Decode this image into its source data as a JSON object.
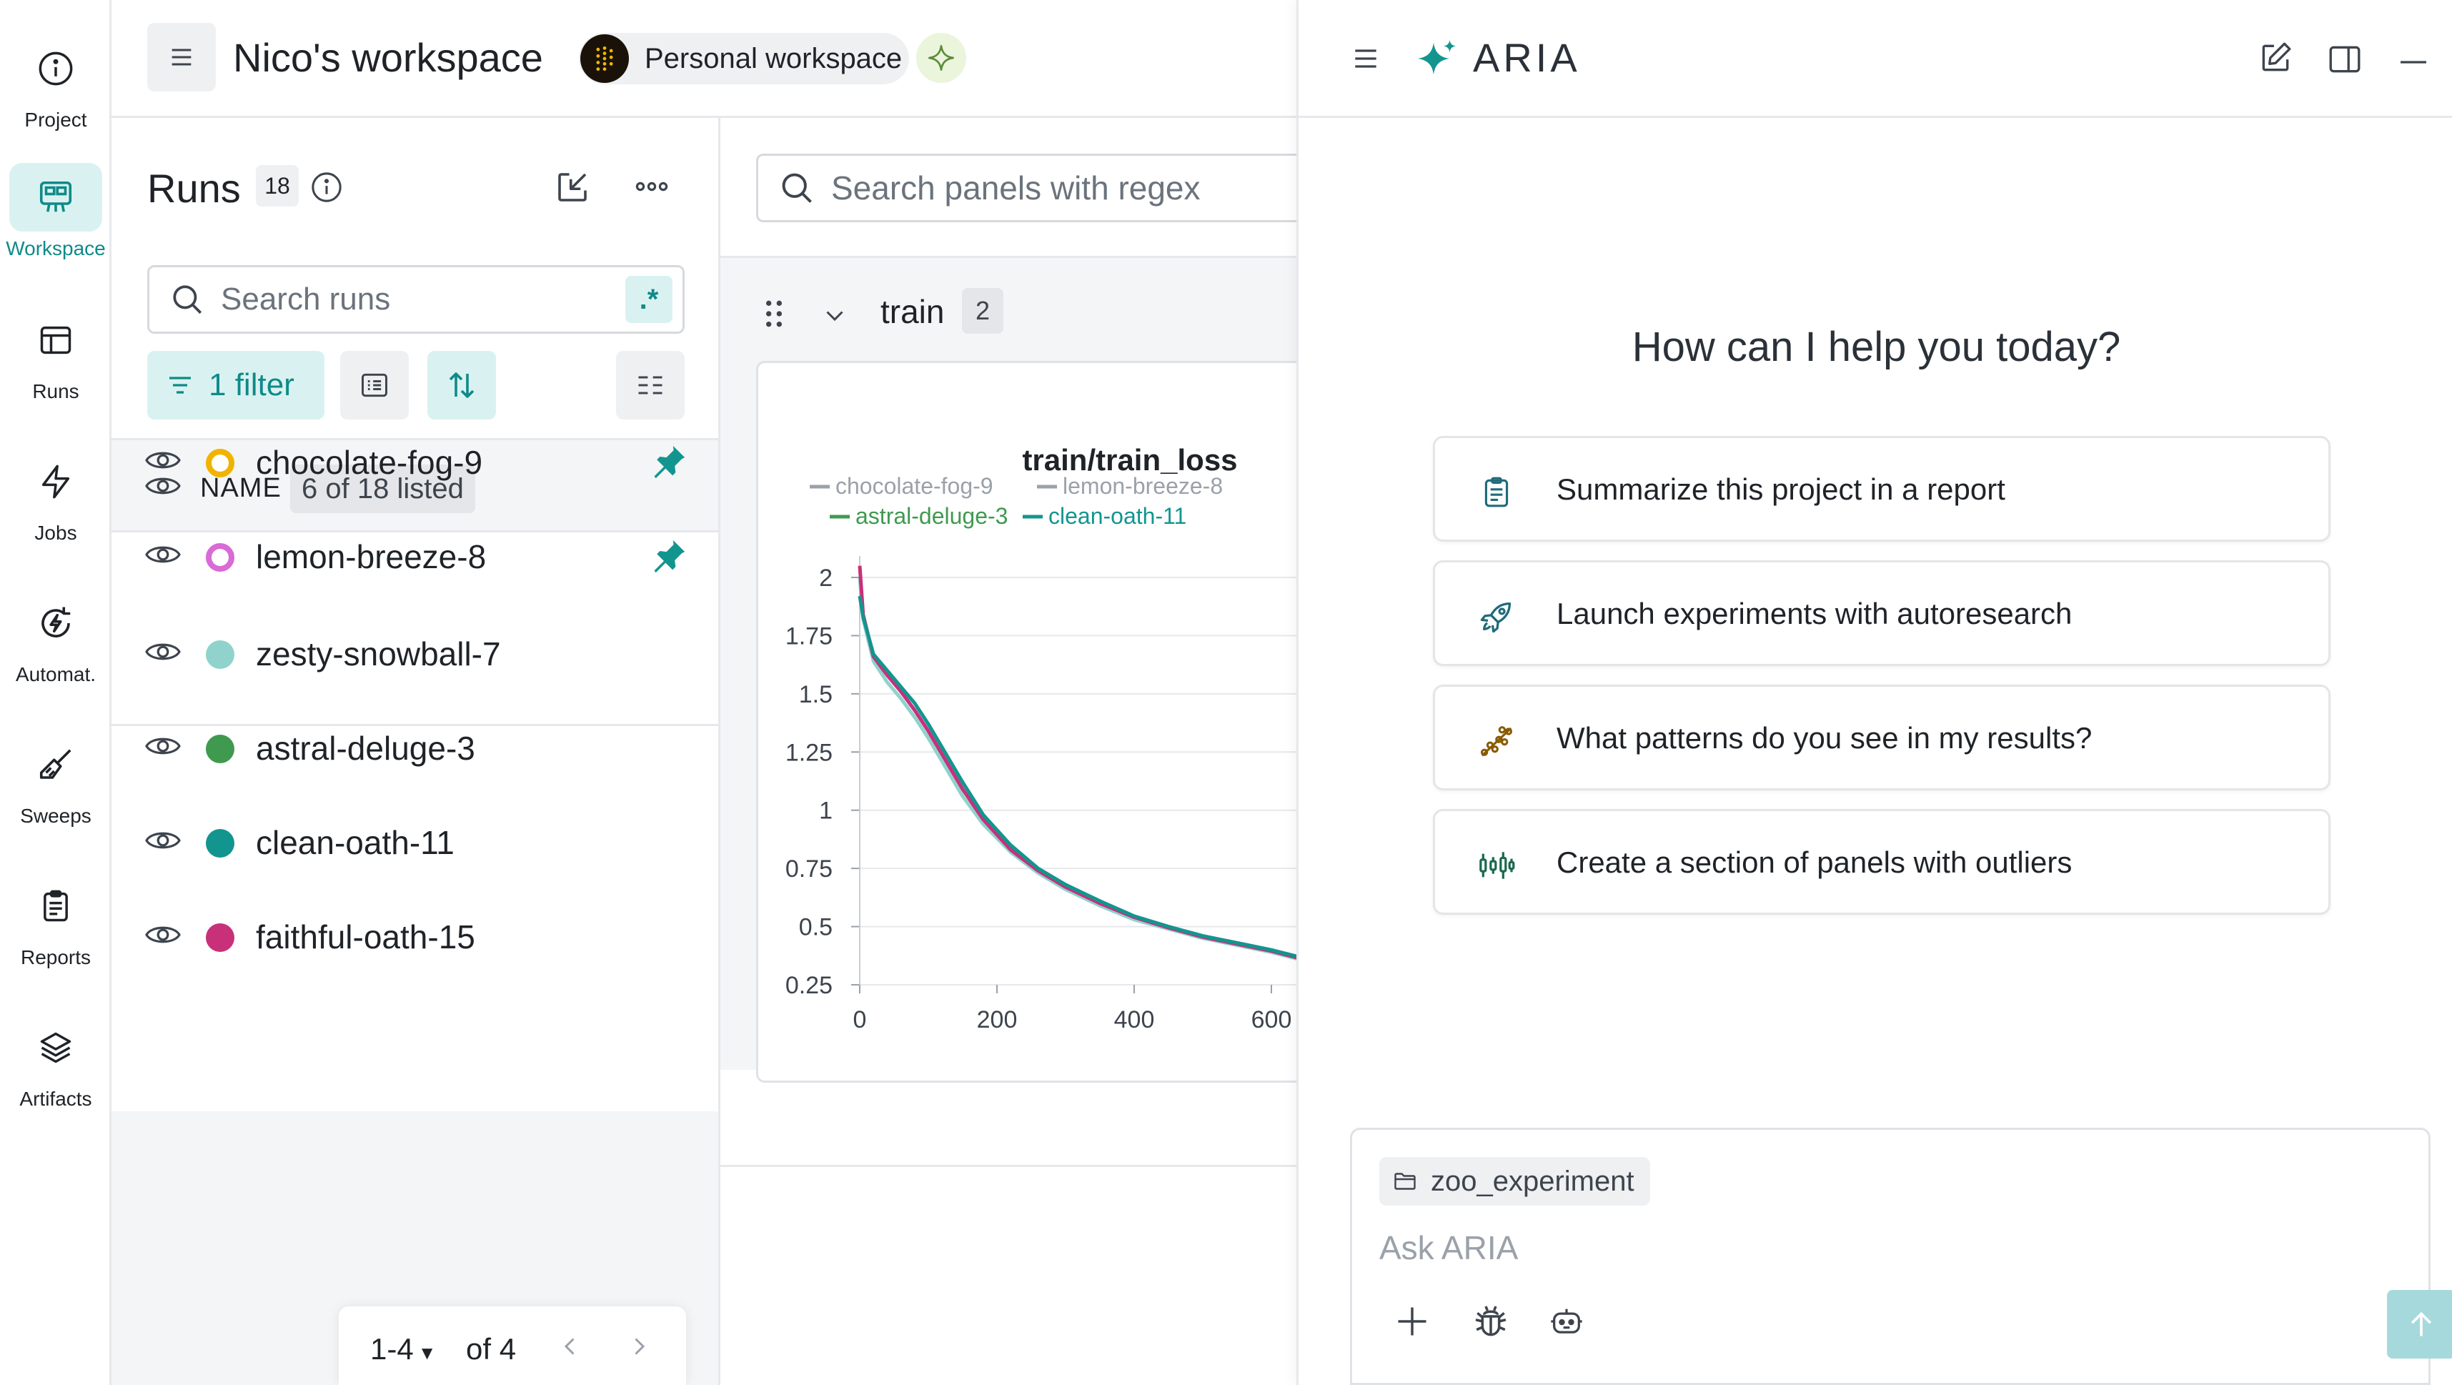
{
  "nav": {
    "items": [
      {
        "label": "Project",
        "icon": "info-icon",
        "active": false
      },
      {
        "label": "Workspace",
        "icon": "workspace-icon",
        "active": true
      },
      {
        "label": "Runs",
        "icon": "table-icon",
        "active": false
      },
      {
        "label": "Jobs",
        "icon": "lightning-icon",
        "active": false
      },
      {
        "label": "Automat.",
        "icon": "automation-icon",
        "active": false
      },
      {
        "label": "Sweeps",
        "icon": "broom-icon",
        "active": false
      },
      {
        "label": "Reports",
        "icon": "report-icon",
        "active": false
      },
      {
        "label": "Artifacts",
        "icon": "layers-icon",
        "active": false
      }
    ]
  },
  "topbar": {
    "title": "Nico's workspace",
    "workspace_pill": "Personal workspace"
  },
  "runs": {
    "title": "Runs",
    "count": "18",
    "search_placeholder": "Search runs",
    "regex_label": ".*",
    "filter_label": "1 filter",
    "header_name": "NAME",
    "header_listed": "6 of 18 listed",
    "items": [
      {
        "name": "chocolate-fog-9",
        "color": "#f0b400",
        "ring": true,
        "pinned": true
      },
      {
        "name": "lemon-breeze-8",
        "color": "#d96ad6",
        "ring": true,
        "pinned": true
      },
      {
        "name": "zesty-snowball-7",
        "color": "#8fd3cc",
        "ring": false,
        "pinned": false
      },
      {
        "name": "astral-deluge-3",
        "color": "#3f9a4f",
        "ring": false,
        "pinned": false
      },
      {
        "name": "clean-oath-11",
        "color": "#13958f",
        "ring": false,
        "pinned": false
      },
      {
        "name": "faithful-oath-15",
        "color": "#c8307a",
        "ring": false,
        "pinned": false
      }
    ],
    "pager": {
      "range": "1-4",
      "of": "of 4"
    }
  },
  "panels": {
    "search_placeholder": "Search panels with regex",
    "section_title": "train",
    "section_count": "2"
  },
  "chart_data": {
    "type": "line",
    "title": "train/train_loss",
    "xlabel": "",
    "ylabel": "",
    "x_ticks": [
      "0",
      "200",
      "400",
      "600"
    ],
    "y_ticks": [
      "2",
      "1.75",
      "1.5",
      "1.25",
      "1",
      "0.75",
      "0.5",
      "0.25"
    ],
    "xlim": [
      0,
      640
    ],
    "ylim": [
      0.25,
      2.05
    ],
    "grid": true,
    "legend_position": "top",
    "legend": [
      {
        "name": "chocolate-fog-9",
        "color": "#9aa1a9"
      },
      {
        "name": "lemon-breeze-8",
        "color": "#9aa1a9"
      },
      {
        "name": "astral-deluge-3",
        "color": "#3f9a4f"
      },
      {
        "name": "clean-oath-11",
        "color": "#13958f"
      }
    ],
    "series": [
      {
        "name": "zesty-snowball-7",
        "color": "#8fd3cc",
        "x": [
          0,
          5,
          20,
          40,
          60,
          80,
          100,
          120,
          150,
          180,
          220,
          260,
          300,
          350,
          400,
          450,
          500,
          550,
          600,
          640
        ],
        "y": [
          2.0,
          1.82,
          1.64,
          1.55,
          1.48,
          1.4,
          1.31,
          1.21,
          1.06,
          0.94,
          0.82,
          0.73,
          0.66,
          0.59,
          0.53,
          0.49,
          0.45,
          0.42,
          0.39,
          0.36
        ]
      },
      {
        "name": "faithful-oath-15",
        "color": "#c8307a",
        "x": [
          0,
          5,
          20,
          40,
          60,
          80,
          100,
          120,
          150,
          180,
          220,
          260,
          300,
          350,
          400,
          450,
          500,
          550,
          600,
          640
        ],
        "y": [
          2.05,
          1.84,
          1.66,
          1.58,
          1.51,
          1.43,
          1.34,
          1.24,
          1.09,
          0.96,
          0.83,
          0.74,
          0.67,
          0.6,
          0.54,
          0.495,
          0.455,
          0.425,
          0.395,
          0.365
        ]
      },
      {
        "name": "clean-oath-11",
        "color": "#13958f",
        "x": [
          0,
          5,
          20,
          40,
          60,
          80,
          100,
          120,
          150,
          180,
          220,
          260,
          300,
          350,
          400,
          450,
          500,
          550,
          600,
          640
        ],
        "y": [
          1.92,
          1.83,
          1.67,
          1.6,
          1.53,
          1.46,
          1.37,
          1.27,
          1.12,
          0.98,
          0.85,
          0.75,
          0.68,
          0.61,
          0.545,
          0.5,
          0.46,
          0.43,
          0.4,
          0.37
        ]
      }
    ]
  },
  "aria": {
    "name": "ARIA",
    "question": "How can I help you today?",
    "suggestions": [
      {
        "text": "Summarize this project in a report",
        "icon": "report-icon",
        "bg": "#dff0f5"
      },
      {
        "text": "Launch experiments with autoresearch",
        "icon": "rocket-icon",
        "bg": "#dff0f5"
      },
      {
        "text": "What patterns do you see in my results?",
        "icon": "scatter-icon",
        "bg": "#fbf0d8"
      },
      {
        "text": "Create a section of panels with outliers",
        "icon": "candlestick-icon",
        "bg": "#e1f2ea"
      }
    ],
    "context_chip": "zoo_experiment",
    "input_placeholder": "Ask ARIA"
  }
}
